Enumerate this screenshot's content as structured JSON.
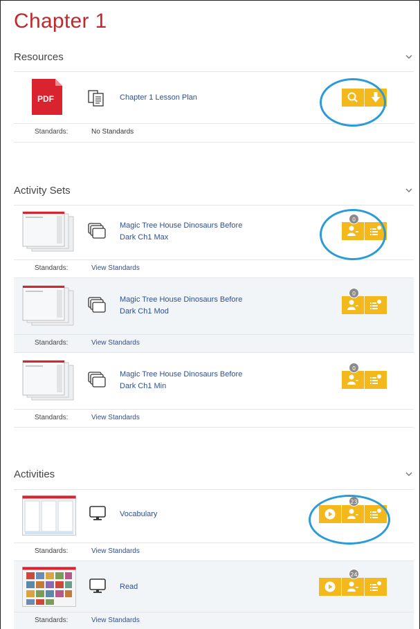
{
  "page": {
    "title": "Chapter 1"
  },
  "resources": {
    "heading": "Resources",
    "items": [
      {
        "link": "Chapter 1 Lesson Plan",
        "thumb_label": "PDF",
        "standards_label": "Standards:",
        "standards_value": "No Standards"
      }
    ]
  },
  "activity_sets": {
    "heading": "Activity Sets",
    "items": [
      {
        "link_line1": "Magic Tree House Dinosaurs Before",
        "link_line2": "Dark Ch1 Max",
        "badge": "0",
        "standards_label": "Standards:",
        "standards_value": "View Standards"
      },
      {
        "link_line1": "Magic Tree House Dinosaurs Before",
        "link_line2": "Dark Ch1 Mod",
        "badge": "0",
        "standards_label": "Standards:",
        "standards_value": "View Standards"
      },
      {
        "link_line1": "Magic Tree House Dinosaurs Before",
        "link_line2": "Dark Ch1 Min",
        "badge": "0",
        "standards_label": "Standards:",
        "standards_value": "View Standards"
      }
    ]
  },
  "activities": {
    "heading": "Activities",
    "items": [
      {
        "link": "Vocabulary",
        "badge": "23",
        "standards_label": "Standards:",
        "standards_value": "View Standards"
      },
      {
        "link": "Read",
        "badge": "24",
        "standards_label": "Standards:",
        "standards_value": "View Standards"
      }
    ]
  },
  "colors": {
    "title": "#c0282d",
    "button": "#f2b81c",
    "link": "#2e4f8f",
    "highlight_ring": "#2b9ad9",
    "pdf": "#d9232e"
  },
  "icons": [
    "chevron-down-icon",
    "pdf-icon",
    "document-copy-icon",
    "search-icon",
    "download-icon",
    "stacked-pages-icon",
    "assign-user-icon",
    "list-settings-icon",
    "monitor-icon",
    "play-icon"
  ]
}
